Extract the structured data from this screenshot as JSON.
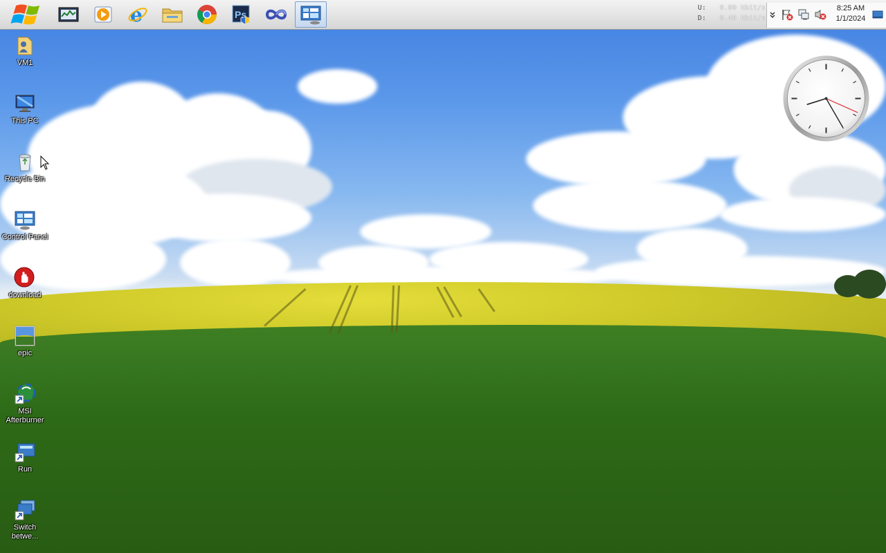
{
  "taskbar": {
    "start_button": "start-orb-icon",
    "pinned": [
      {
        "name": "task-manager-icon"
      },
      {
        "name": "media-player-icon"
      },
      {
        "name": "internet-explorer-icon"
      },
      {
        "name": "file-explorer-icon"
      },
      {
        "name": "chrome-icon"
      },
      {
        "name": "photoshop-icon",
        "text": "Ps"
      },
      {
        "name": "infinity-app-icon"
      },
      {
        "name": "control-panel-icon",
        "active": true
      }
    ],
    "net_monitor": {
      "upload_label": "U:",
      "upload_value": "0.00 kbit/s",
      "download_label": "D:",
      "download_value": "0.48 kbit/s"
    },
    "tray_icons": [
      "show-hidden-chevron-icon",
      "action-center-flag-icon",
      "network-icon",
      "volume-muted-icon"
    ],
    "clock": {
      "time": "8:25 AM",
      "date": "1/1/2024"
    },
    "show_desktop": "show-desktop-icon"
  },
  "desktop": {
    "icons": [
      {
        "label": "VM1",
        "icon": "user-folder-icon"
      },
      {
        "label": "This PC",
        "icon": "computer-icon"
      },
      {
        "label": "Recycle Bin",
        "icon": "recycle-bin-icon"
      },
      {
        "label": "Control Panel",
        "icon": "control-panel-icon"
      },
      {
        "label": "download",
        "icon": "download-hand-icon"
      },
      {
        "label": "epic",
        "icon": "image-file-icon"
      },
      {
        "label": "MSI Afterburner",
        "icon": "afterburner-shortcut-icon"
      },
      {
        "label": "Run",
        "icon": "run-shortcut-icon"
      },
      {
        "label": "Switch betwe...",
        "icon": "switch-windows-shortcut-icon"
      }
    ]
  },
  "clock_gadget": {
    "hour": 8,
    "minute": 25,
    "second": 19
  },
  "colors": {
    "accent": "#3f7ee0",
    "taskbar": "#e2e2e2",
    "second_hand": "#d22"
  }
}
